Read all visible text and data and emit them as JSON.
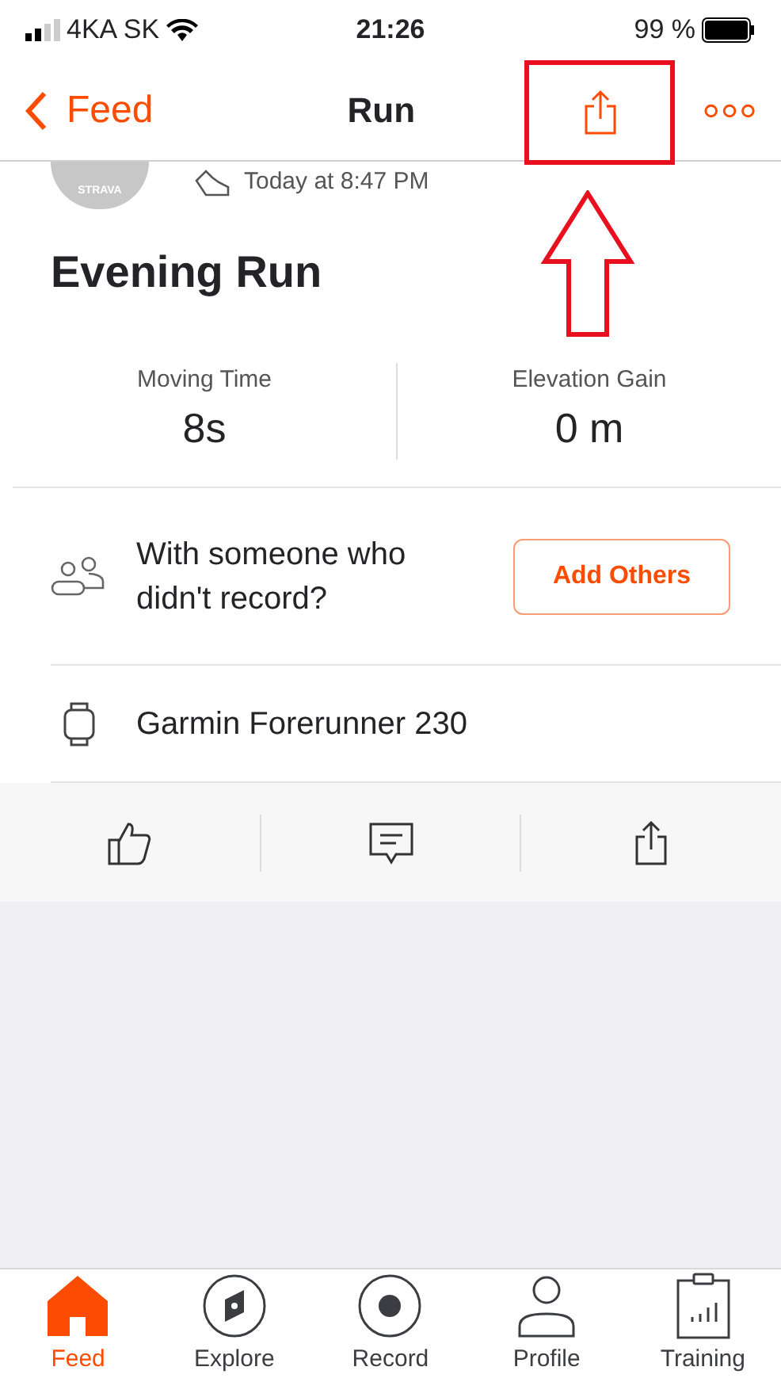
{
  "status_bar": {
    "carrier": "4KA SK",
    "time": "21:26",
    "battery": "99 %"
  },
  "nav": {
    "back": "Feed",
    "title": "Run"
  },
  "activity": {
    "avatar_text": "STRAVA",
    "time": "Today at 8:47 PM",
    "title": "Evening Run"
  },
  "stats": [
    {
      "label": "Moving Time",
      "value": "8s"
    },
    {
      "label": "Elevation Gain",
      "value": "0 m"
    }
  ],
  "group_prompt": {
    "text": "With someone who didn't record?",
    "button": "Add Others"
  },
  "device": "Garmin Forerunner 230",
  "tabs": [
    {
      "label": "Feed",
      "kind": "home",
      "selected": true
    },
    {
      "label": "Explore",
      "kind": "compass",
      "selected": false
    },
    {
      "label": "Record",
      "kind": "record",
      "selected": false
    },
    {
      "label": "Profile",
      "kind": "person",
      "selected": false
    },
    {
      "label": "Training",
      "kind": "clipboard",
      "selected": false
    }
  ]
}
